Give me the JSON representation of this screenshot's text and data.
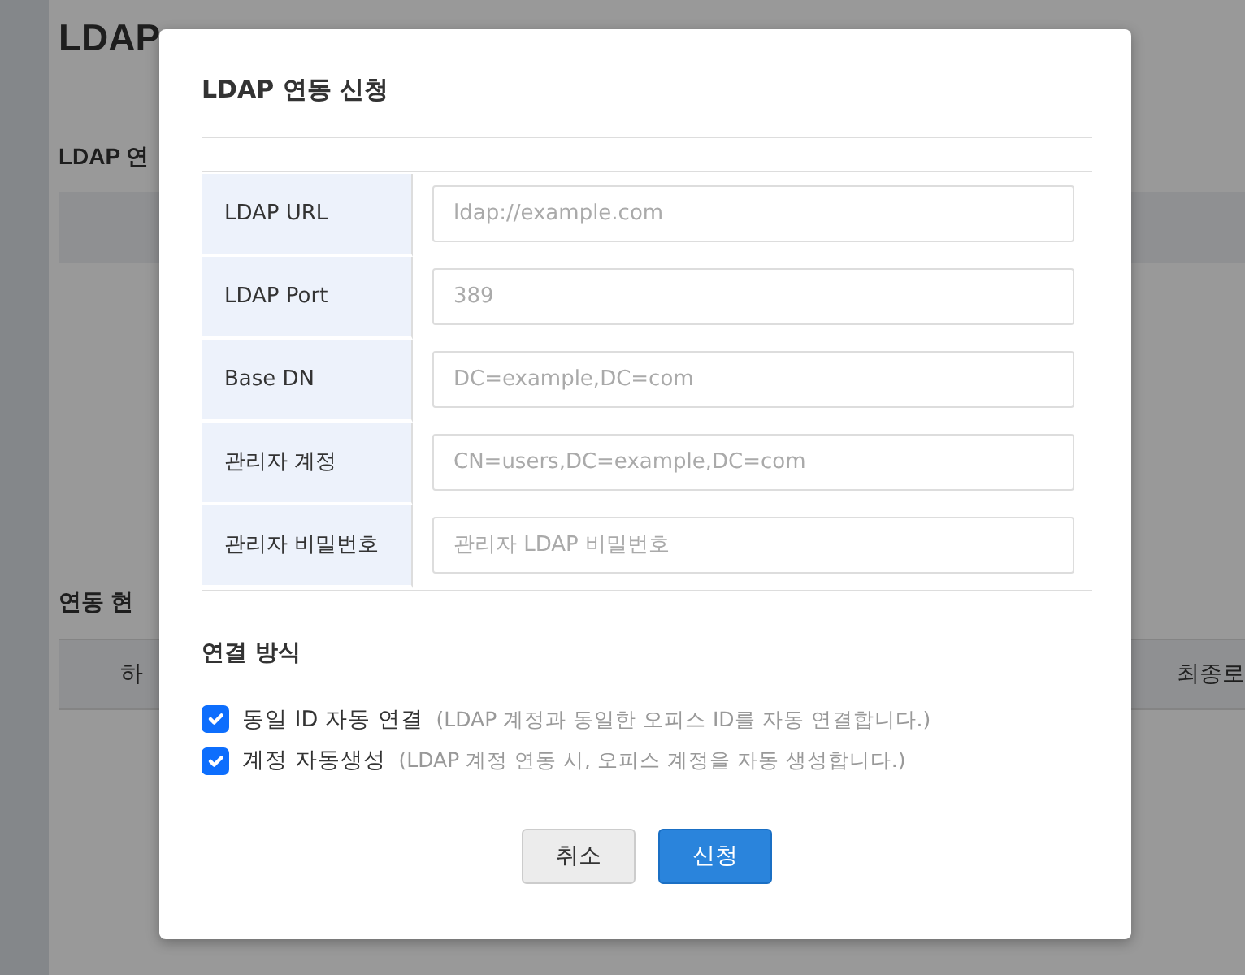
{
  "page": {
    "title": "LDAP",
    "section_title": "LDAP 연",
    "status_title": "연동 현",
    "status_table_columns": [
      "하",
      "최종로"
    ]
  },
  "dialog": {
    "title": "LDAP 연동 신청",
    "fields": [
      {
        "label": "LDAP URL",
        "placeholder": "ldap://example.com"
      },
      {
        "label": "LDAP Port",
        "placeholder": "389"
      },
      {
        "label": "Base DN",
        "placeholder": "DC=example,DC=com"
      },
      {
        "label": "관리자 계정",
        "placeholder": "CN=users,DC=example,DC=com"
      },
      {
        "label": "관리자 비밀번호",
        "placeholder": "관리자 LDAP 비밀번호"
      }
    ],
    "connection_title": "연결 방식",
    "options": [
      {
        "label": "동일 ID 자동 연결",
        "hint": "(LDAP 계정과 동일한 오피스 ID를 자동 연결합니다.)",
        "checked": true
      },
      {
        "label": "계정 자동생성",
        "hint": "(LDAP 계정 연동 시, 오피스 계정을 자동 생성합니다.)",
        "checked": true
      }
    ],
    "buttons": [
      {
        "label": "취소",
        "kind": "secondary"
      },
      {
        "label": "신청",
        "kind": "primary"
      }
    ]
  }
}
